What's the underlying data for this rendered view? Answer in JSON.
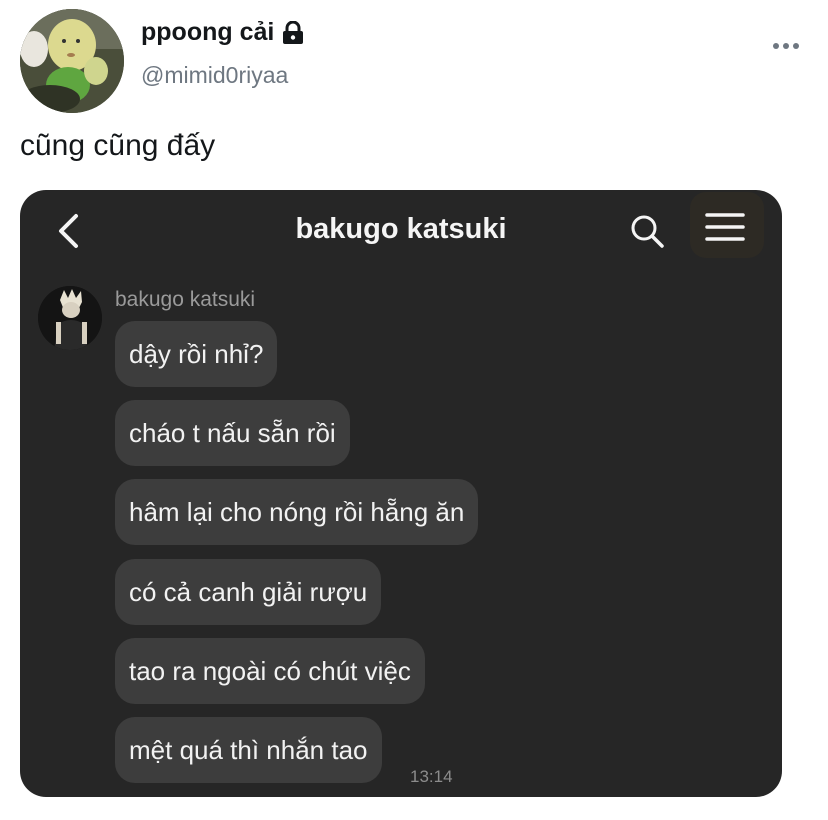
{
  "tweet": {
    "display_name": "ppoong cải",
    "handle": "@mimid0riyaa",
    "text": "cũng cũng đấy",
    "avatar_icon": "avatar-image",
    "lock_icon": "lock-icon",
    "more_icon": "more-options-icon"
  },
  "chat": {
    "title": "bakugo katsuki",
    "sender_name": "bakugo katsuki",
    "messages": [
      "dậy rồi nhỉ?",
      "cháo t nấu sẵn rồi",
      "hâm lại cho nóng rồi hẵng ăn",
      "có cả canh giải rượu",
      "tao ra ngoài có chút việc",
      "mệt quá thì nhắn tao"
    ],
    "timestamp": "13:14",
    "icons": [
      "back-arrow-icon",
      "search-icon",
      "menu-icon"
    ]
  },
  "colors": {
    "chat_background": "#262626",
    "bubble_background": "#3d3d3d",
    "menu_highlight": "#2d2a24"
  }
}
